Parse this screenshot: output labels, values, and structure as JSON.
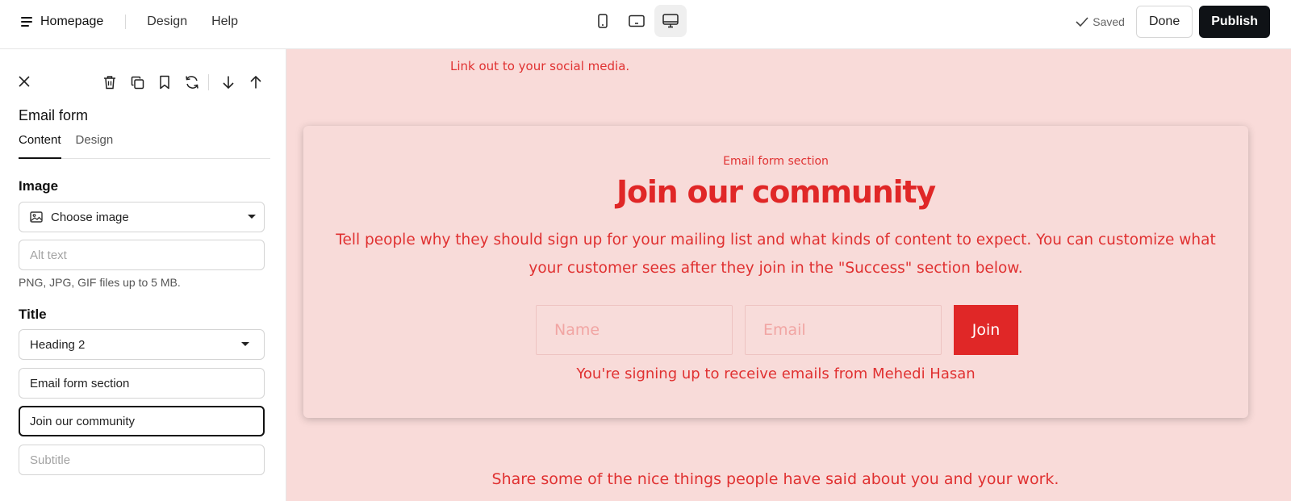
{
  "topbar": {
    "title": "Homepage",
    "nav": [
      "Design",
      "Help"
    ],
    "devices": [
      "mobile",
      "tablet",
      "desktop"
    ],
    "active_device": "desktop",
    "saved_label": "Saved",
    "done_label": "Done",
    "publish_label": "Publish"
  },
  "panel": {
    "heading": "Email form",
    "tabs": [
      "Content",
      "Design"
    ],
    "active_tab": "Content",
    "image": {
      "label": "Image",
      "choose_label": "Choose image",
      "alt_placeholder": "Alt text",
      "helper": "PNG, JPG, GIF files up to 5 MB."
    },
    "title": {
      "label": "Title",
      "heading_level": "Heading 2",
      "eyebrow_value": "Email form section",
      "title_value": "Join our community",
      "subtitle_placeholder": "Subtitle"
    }
  },
  "canvas": {
    "social_text": "Link out to your social media.",
    "card": {
      "eyebrow": "Email form section",
      "title": "Join our community",
      "description": "Tell people why they should sign up for your mailing list and what kinds of content to expect. You can customize what your customer sees after they join in the \"Success\" section below.",
      "name_placeholder": "Name",
      "email_placeholder": "Email",
      "join_label": "Join",
      "note": "You're signing up to receive emails from Mehedi Hasan"
    },
    "share_text": "Share some of the nice things people have said about you and your work."
  },
  "colors": {
    "accent": "#e02727",
    "canvas_bg": "#f9dbd9",
    "publish_bg": "#0f1216"
  }
}
